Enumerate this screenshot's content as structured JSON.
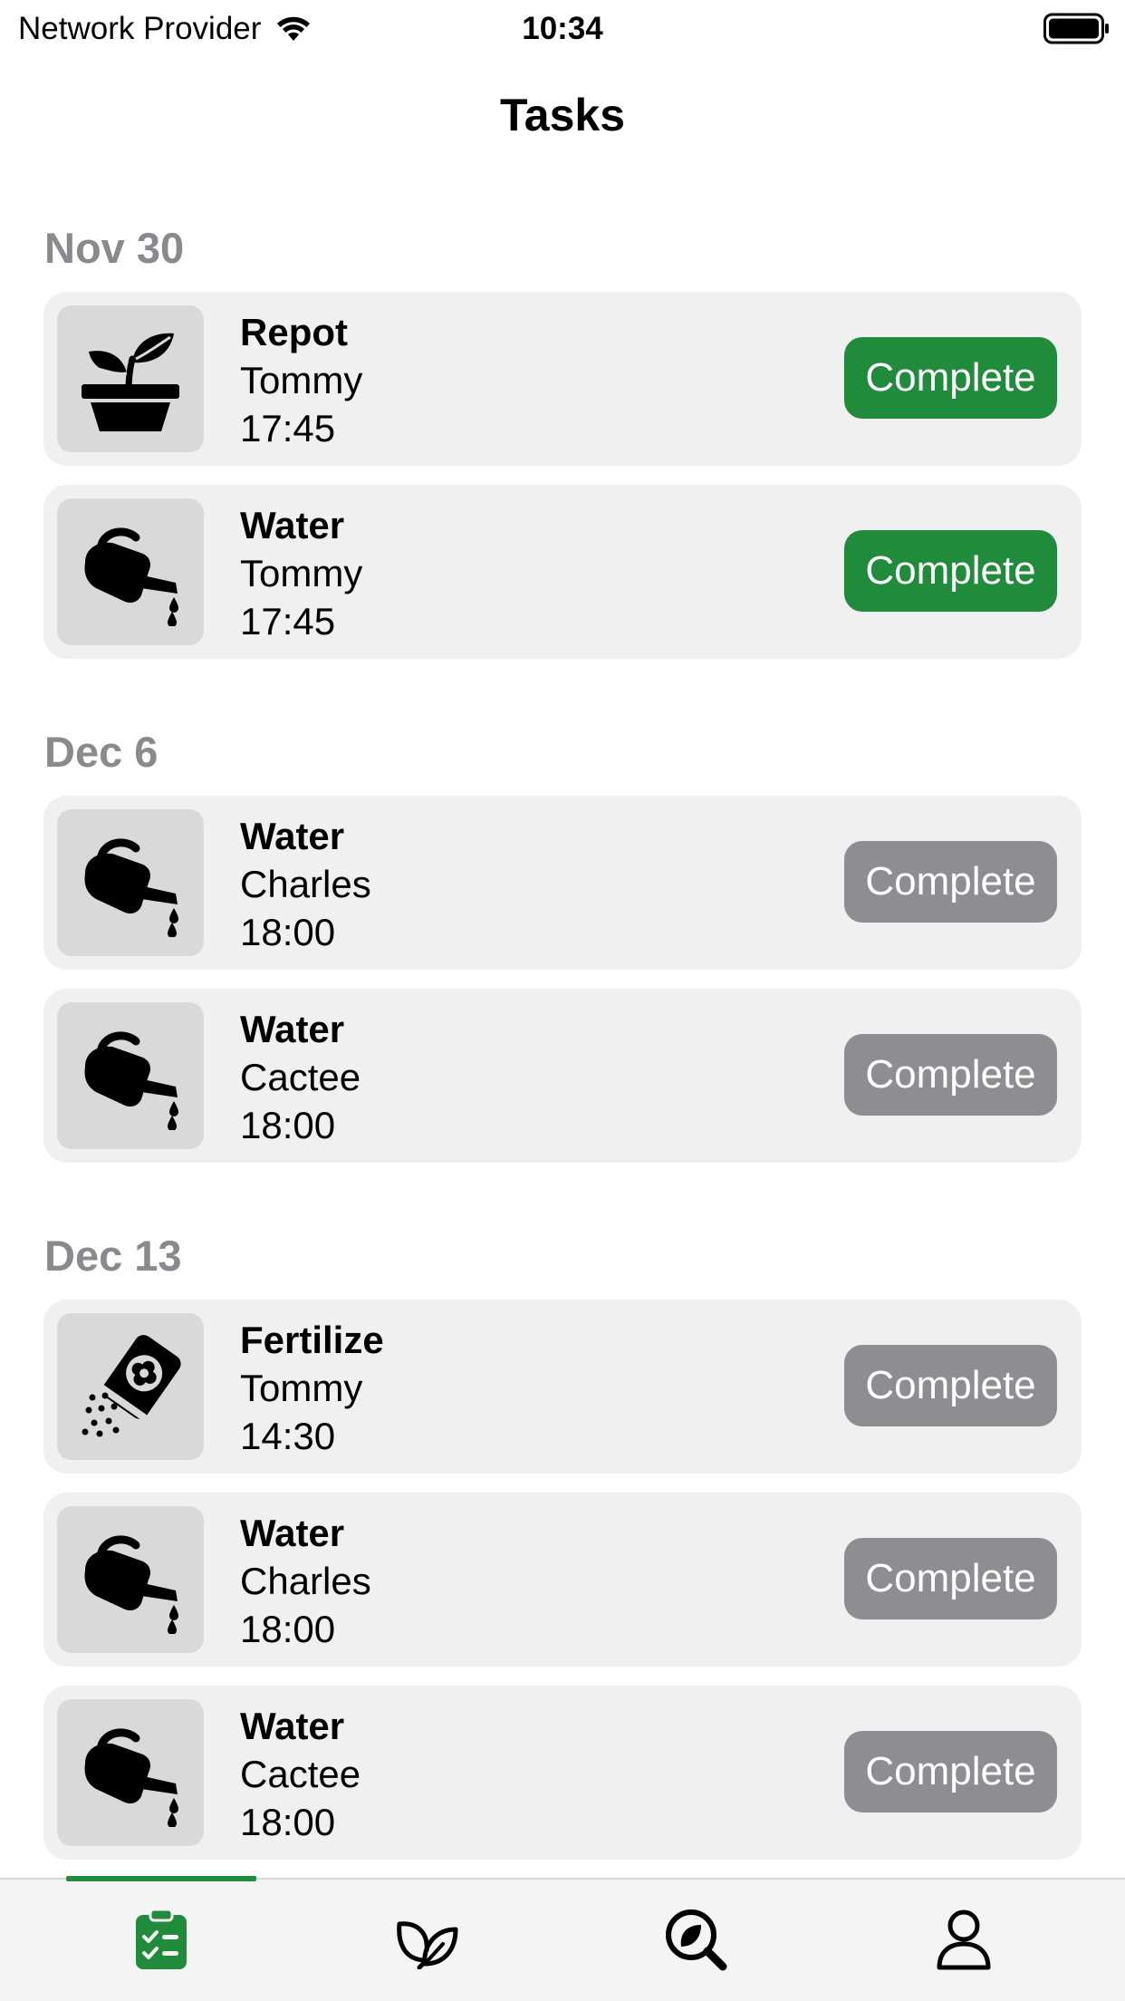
{
  "status_bar": {
    "carrier": "Network Provider",
    "time": "10:34"
  },
  "nav": {
    "title": "Tasks"
  },
  "sections": [
    {
      "date": "Nov 30",
      "tasks": [
        {
          "type": "Repot",
          "plant": "Tommy",
          "time": "17:45",
          "icon": "potted-plant-icon",
          "button": "Complete",
          "button_state": "active"
        },
        {
          "type": "Water",
          "plant": "Tommy",
          "time": "17:45",
          "icon": "watering-can-icon",
          "button": "Complete",
          "button_state": "active"
        }
      ]
    },
    {
      "date": "Dec 6",
      "tasks": [
        {
          "type": "Water",
          "plant": "Charles",
          "time": "18:00",
          "icon": "watering-can-icon",
          "button": "Complete",
          "button_state": "inactive"
        },
        {
          "type": "Water",
          "plant": "Cactee",
          "time": "18:00",
          "icon": "watering-can-icon",
          "button": "Complete",
          "button_state": "inactive"
        }
      ]
    },
    {
      "date": "Dec 13",
      "tasks": [
        {
          "type": "Fertilize",
          "plant": "Tommy",
          "time": "14:30",
          "icon": "fertilizer-bag-icon",
          "button": "Complete",
          "button_state": "inactive"
        },
        {
          "type": "Water",
          "plant": "Charles",
          "time": "18:00",
          "icon": "watering-can-icon",
          "button": "Complete",
          "button_state": "inactive"
        },
        {
          "type": "Water",
          "plant": "Cactee",
          "time": "18:00",
          "icon": "watering-can-icon",
          "button": "Complete",
          "button_state": "inactive"
        }
      ]
    }
  ],
  "tab_bar": {
    "items": [
      {
        "icon": "clipboard-checklist-icon",
        "selected": true
      },
      {
        "icon": "leaves-icon",
        "selected": false
      },
      {
        "icon": "plant-search-icon",
        "selected": false
      },
      {
        "icon": "person-icon",
        "selected": false
      }
    ]
  },
  "colors": {
    "accent": "#1f8b3b",
    "inactive_button": "#8e8e92",
    "section_header": "#8a8a8e",
    "card_background": "#f0f0f0",
    "icon_box_background": "#d9d9d9"
  }
}
